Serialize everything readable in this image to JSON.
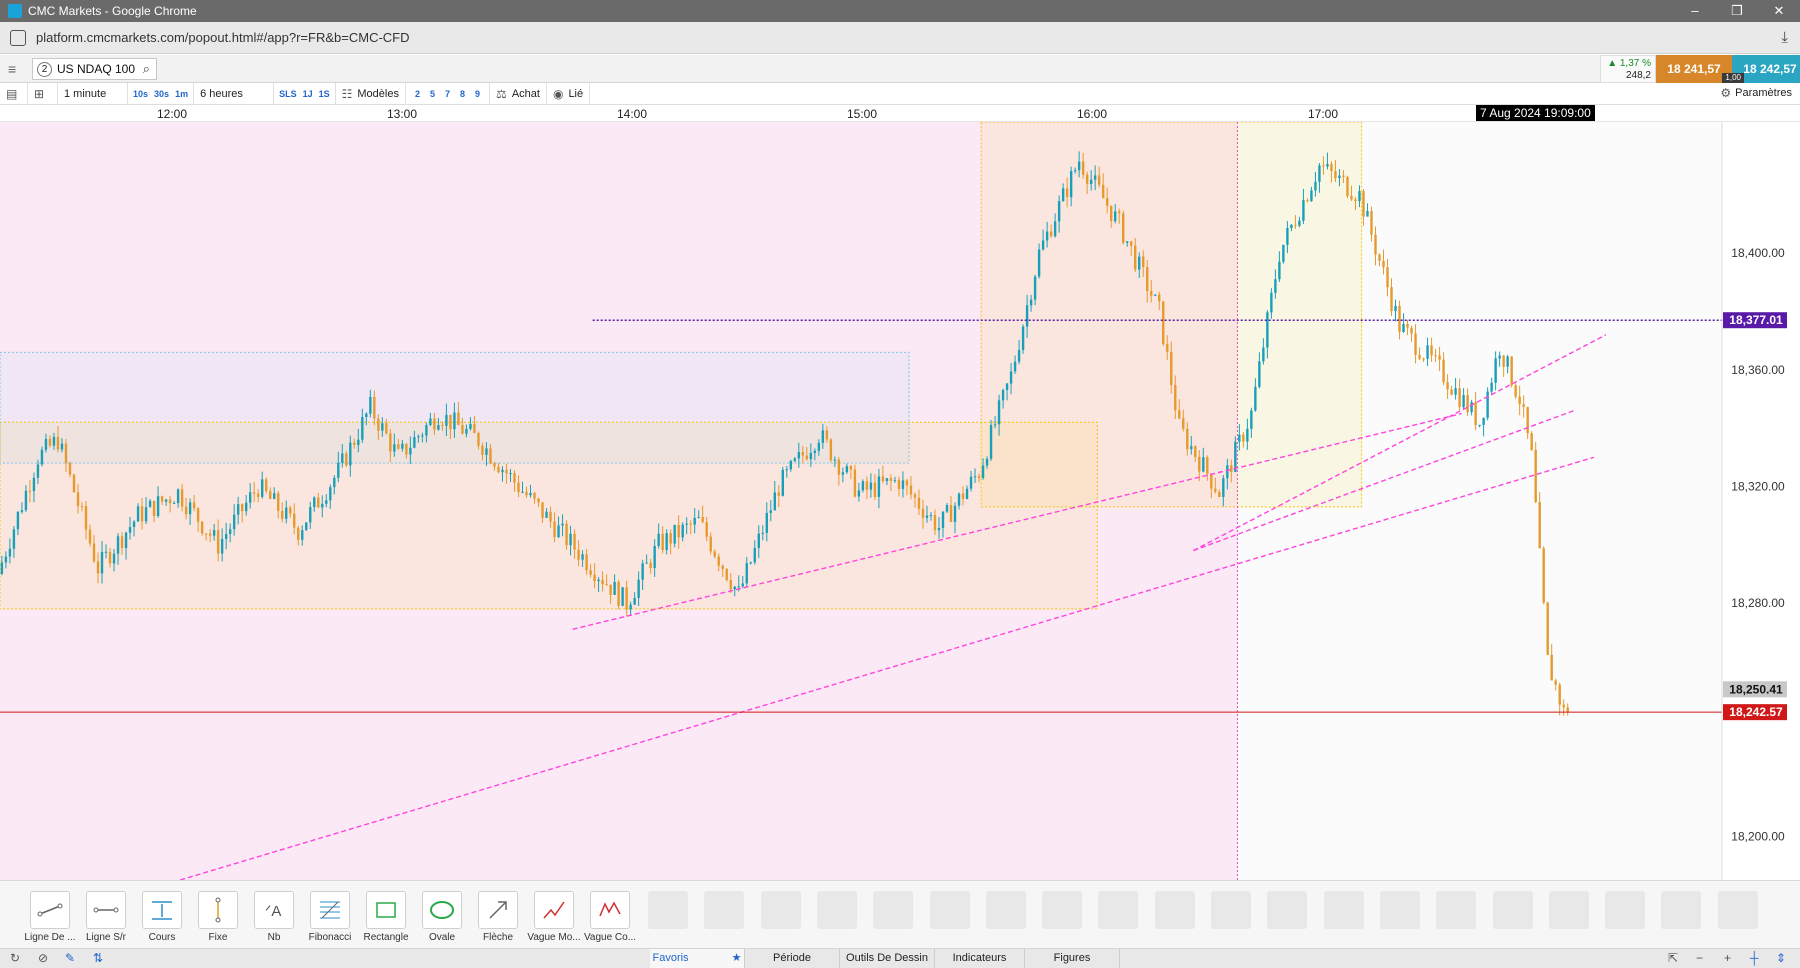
{
  "window": {
    "title": "CMC Markets - Google Chrome",
    "url": "platform.cmcmarkets.com/popout.html#/app?r=FR&b=CMC-CFD"
  },
  "instrument": {
    "number": "2",
    "name": "US NDAQ 100"
  },
  "quote": {
    "change_pct": "▲ 1,37 %",
    "change_pts": "248,2",
    "sell": "18 241,57",
    "buy": "18 242,57",
    "spread": "1,00"
  },
  "toolbar": {
    "interval": "1 minute",
    "quick_intervals": [
      "10s",
      "30s",
      "1m"
    ],
    "range": "6 heures",
    "quick_ranges": [
      "SLS",
      "1J",
      "1S"
    ],
    "models_label": "Modèles",
    "model_slots": [
      "2",
      "5",
      "7",
      "8",
      "9"
    ],
    "buy_label": "Achat",
    "linked_label": "Lié",
    "settings_label": "Paramètres"
  },
  "time_axis": {
    "labels": [
      "12:00",
      "13:00",
      "14:00",
      "15:00",
      "16:00",
      "17:00"
    ],
    "cursor_date": "7 Aug 2024 19:09:00"
  },
  "chart_data": {
    "type": "candlestick",
    "instrument": "US NDAQ 100",
    "interval": "1 minute",
    "x_range": [
      "11:25",
      "18:35"
    ],
    "ylim": [
      18185,
      18445
    ],
    "y_ticks": [
      18400,
      18360,
      18320,
      18280,
      18200
    ],
    "y_tick_labels": [
      "18,400.00",
      "18,360.00",
      "18,320.00",
      "18,280.00",
      "18,200.00"
    ],
    "price_labels": {
      "horizontal_line": "18,377.01",
      "previous": "18,250.41",
      "current": "18,242.57"
    },
    "horizontal_line_value": 18377.01,
    "previous_value": 18250.41,
    "current_value": 18242.57,
    "grid": false,
    "price_path": [
      [
        "11:25",
        18290
      ],
      [
        "11:35",
        18330
      ],
      [
        "11:40",
        18336
      ],
      [
        "11:50",
        18292
      ],
      [
        "12:00",
        18310
      ],
      [
        "12:10",
        18318
      ],
      [
        "12:20",
        18300
      ],
      [
        "12:30",
        18320
      ],
      [
        "12:40",
        18305
      ],
      [
        "12:50",
        18325
      ],
      [
        "12:58",
        18347
      ],
      [
        "13:05",
        18330
      ],
      [
        "13:15",
        18345
      ],
      [
        "13:25",
        18336
      ],
      [
        "13:35",
        18320
      ],
      [
        "13:45",
        18305
      ],
      [
        "13:55",
        18290
      ],
      [
        "14:02",
        18280
      ],
      [
        "14:10",
        18300
      ],
      [
        "14:20",
        18308
      ],
      [
        "14:30",
        18283
      ],
      [
        "14:40",
        18320
      ],
      [
        "14:50",
        18338
      ],
      [
        "15:00",
        18318
      ],
      [
        "15:10",
        18322
      ],
      [
        "15:20",
        18306
      ],
      [
        "15:30",
        18325
      ],
      [
        "15:38",
        18358
      ],
      [
        "15:45",
        18400
      ],
      [
        "15:55",
        18432
      ],
      [
        "16:05",
        18410
      ],
      [
        "16:15",
        18380
      ],
      [
        "16:20",
        18340
      ],
      [
        "16:30",
        18318
      ],
      [
        "16:38",
        18345
      ],
      [
        "16:45",
        18400
      ],
      [
        "16:55",
        18430
      ],
      [
        "17:05",
        18420
      ],
      [
        "17:15",
        18375
      ],
      [
        "17:25",
        18360
      ],
      [
        "17:35",
        18342
      ],
      [
        "17:40",
        18368
      ],
      [
        "17:45",
        18350
      ],
      [
        "17:48",
        18330
      ],
      [
        "17:50",
        18295
      ],
      [
        "17:52",
        18260
      ],
      [
        "17:55",
        18247
      ],
      [
        "17:56",
        18242.57
      ]
    ],
    "vertical_line_time": "16:34",
    "zones": [
      {
        "kind": "background",
        "from": "11:25",
        "to": "16:34",
        "color": "#fce9f6"
      },
      {
        "kind": "rect",
        "from": "11:25",
        "to": "15:59",
        "low": 18278,
        "high": 18342,
        "color": "#f5c400"
      },
      {
        "kind": "rect",
        "from": "11:25",
        "to": "15:12",
        "low": 18328,
        "high": 18366,
        "color": "#7ec8e8"
      },
      {
        "kind": "rect",
        "from": "15:30",
        "to": "17:05",
        "low": 18313,
        "high": 18445,
        "color": "#f5c400"
      }
    ],
    "trendlines": [
      {
        "from": [
          "13:48",
          18271
        ],
        "to": [
          "17:30",
          18345
        ],
        "color": "#ff44dd"
      },
      {
        "from": [
          "16:23",
          18298
        ],
        "to": [
          "17:58",
          18346
        ],
        "color": "#ff44dd"
      },
      {
        "from": [
          "12:10",
          18185
        ],
        "to": [
          "18:03",
          18330
        ],
        "color": "#ff44dd"
      },
      {
        "from": [
          "16:23",
          18298
        ],
        "to": [
          "18:06",
          18372
        ],
        "color": "#ff44dd"
      }
    ],
    "colors": {
      "up": "#19a0b8",
      "down": "#e69a2e",
      "horizontal_line": "#5a1aa8",
      "current_line": "#d01818",
      "previous_label_bg": "#c8c8c8"
    }
  },
  "drawing_tools": [
    {
      "label": "Ligne De ...",
      "icon": "trend-line-icon"
    },
    {
      "label": "Ligne S/r",
      "icon": "support-resistance-icon"
    },
    {
      "label": "Cours",
      "icon": "price-icon"
    },
    {
      "label": "Fixe",
      "icon": "fixed-icon"
    },
    {
      "label": "Nb",
      "icon": "text-note-icon"
    },
    {
      "label": "Fibonacci",
      "icon": "fibonacci-icon"
    },
    {
      "label": "Rectangle",
      "icon": "rectangle-icon"
    },
    {
      "label": "Ovale",
      "icon": "oval-icon"
    },
    {
      "label": "Flèche",
      "icon": "arrow-icon"
    },
    {
      "label": "Vague Mo...",
      "icon": "wave-motive-icon"
    },
    {
      "label": "Vague Co...",
      "icon": "wave-corrective-icon"
    }
  ],
  "bottom_tabs": [
    "Favoris",
    "Période",
    "Outils De Dessin",
    "Indicateurs",
    "Figures"
  ],
  "active_tab": "Favoris"
}
